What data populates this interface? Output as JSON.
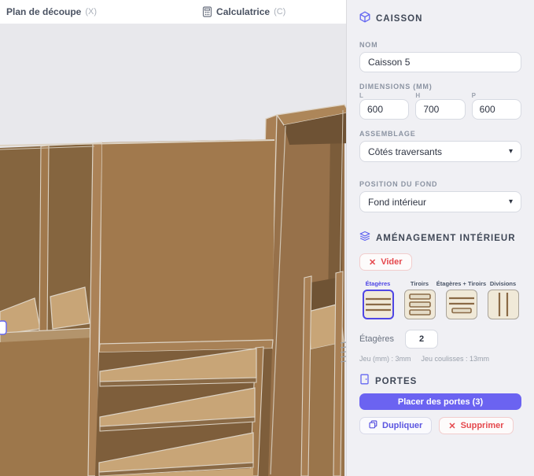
{
  "topbar": {
    "tabs": [
      {
        "label": "Plan de découpe",
        "shortcut": "(X)"
      },
      {
        "label": "Calculatrice",
        "shortcut": "(C)",
        "icon": "calculator-icon"
      }
    ]
  },
  "panel": {
    "caisson": {
      "title": "CAISSON",
      "icon": "cube-icon",
      "nom_label": "NOM",
      "nom_value": "Caisson 5",
      "dimensions_label": "DIMENSIONS (MM)",
      "dims": [
        {
          "label": "L",
          "value": "600"
        },
        {
          "label": "H",
          "value": "700"
        },
        {
          "label": "P",
          "value": "600"
        }
      ],
      "assemblage_label": "ASSEMBLAGE",
      "assemblage_value": "Côtés traversants",
      "fond_label": "POSITION DU FOND",
      "fond_value": "Fond intérieur"
    },
    "amenagement": {
      "title": "AMÉNAGEMENT INTÉRIEUR",
      "icon": "layers-icon",
      "vider_label": "Vider",
      "options": [
        {
          "label": "Étagères",
          "selected": true
        },
        {
          "label": "Tiroirs",
          "selected": false
        },
        {
          "label": "Étagères + Tiroirs",
          "selected": false
        },
        {
          "label": "Divisions",
          "selected": false
        }
      ],
      "etageres_label": "Étagères",
      "etageres_value": "2",
      "jeu_text": "Jeu (mm) : 3mm",
      "jeu_coulisses_text": "Jeu coulisses : 13mm"
    },
    "portes": {
      "title": "PORTES",
      "icon": "door-icon",
      "placer_label": "Placer des portes (3)",
      "dupliquer_label": "Dupliquer",
      "supprimer_label": "Supprimer"
    }
  },
  "viewport": {
    "description": "3D perspective view of an open wooden cabinet (caisson) with shelves, dividers and a tall side column"
  },
  "colors": {
    "accent_indigo": "#6b63f1",
    "selected_tile_border": "#4f46e5",
    "danger_red": "#e5484d",
    "panel_bg": "#f0f0f4",
    "wood_front": "#a1794d",
    "wood_interior": "#7e5e3b",
    "wood_shelf_top": "#c8a577",
    "wood_edge_light": "#ddd3c4",
    "view_bg": "#e8e8ec"
  }
}
